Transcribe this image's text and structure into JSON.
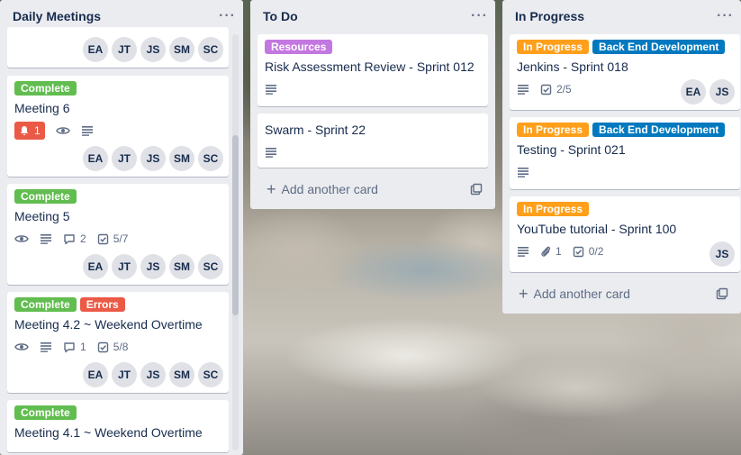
{
  "lists": {
    "daily": {
      "title": "Daily Meetings",
      "cards": [
        {
          "members": [
            "EA",
            "JT",
            "JS",
            "SM",
            "SC"
          ]
        },
        {
          "labels": [
            "Complete"
          ],
          "title": "Meeting 6",
          "alert_count": "1",
          "members": [
            "EA",
            "JT",
            "JS",
            "SM",
            "SC"
          ]
        },
        {
          "labels": [
            "Complete"
          ],
          "title": "Meeting 5",
          "comments": "2",
          "checklist": "5/7",
          "members": [
            "EA",
            "JT",
            "JS",
            "SM",
            "SC"
          ]
        },
        {
          "labels": [
            "Complete",
            "Errors"
          ],
          "title": "Meeting 4.2 ~ Weekend Overtime",
          "comments": "1",
          "checklist": "5/8",
          "members": [
            "EA",
            "JT",
            "JS",
            "SM",
            "SC"
          ]
        },
        {
          "labels": [
            "Complete"
          ],
          "title": "Meeting 4.1 ~ Weekend Overtime"
        }
      ]
    },
    "todo": {
      "title": "To Do",
      "cards": [
        {
          "labels": [
            "Resources"
          ],
          "title": "Risk Assessment Review - Sprint 012"
        },
        {
          "title": "Swarm - Sprint 22"
        }
      ],
      "add_card": "Add another card"
    },
    "progress": {
      "title": "In Progress",
      "cards": [
        {
          "labels": [
            "In Progress",
            "Back End Development"
          ],
          "title": "Jenkins - Sprint 018",
          "checklist": "2/5",
          "members": [
            "EA",
            "JS"
          ]
        },
        {
          "labels": [
            "In Progress",
            "Back End Development"
          ],
          "title": "Testing - Sprint 021"
        },
        {
          "labels": [
            "In Progress"
          ],
          "title": "YouTube tutorial - Sprint 100",
          "attachments": "1",
          "checklist": "0/2",
          "members": [
            "JS"
          ]
        }
      ],
      "add_card": "Add another card"
    }
  },
  "label_colors": {
    "Complete": "#61bd4f",
    "Errors": "#eb5a46",
    "Resources": "#c377e0",
    "In Progress": "#ff9f1a",
    "Back End Development": "#0079bf"
  },
  "menu_glyph": "···"
}
